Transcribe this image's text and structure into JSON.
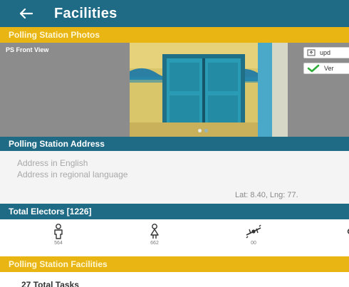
{
  "appbar": {
    "title": "Facilities",
    "back_icon": "arrow-left-icon"
  },
  "photos_section": {
    "title": "Polling Station Photos"
  },
  "photo": {
    "caption": "PS Front View",
    "page_count": 2,
    "current_page": 1
  },
  "side_actions": [
    {
      "label": "upd",
      "icon": "upload-icon"
    },
    {
      "label": "Ver",
      "icon": "check-icon"
    }
  ],
  "address_section": {
    "title": "Polling Station Address",
    "english": "Address in English",
    "regional": "Address in regional language",
    "latlng": "Lat: 8.40, Lng: 77."
  },
  "electors_section": {
    "title": "Total Electors [1226]",
    "items": [
      {
        "icon": "male-voter-icon",
        "value": "564"
      },
      {
        "icon": "female-voter-icon",
        "value": "662"
      },
      {
        "icon": "third-gender-icon",
        "value": "00"
      }
    ]
  },
  "facilities_section": {
    "title": "Polling Station Facilities"
  },
  "tasks": {
    "text": "27 Total Tasks"
  },
  "colors": {
    "primary": "#1f6b86",
    "accent": "#e9b513",
    "check_green": "#2eae3a"
  }
}
